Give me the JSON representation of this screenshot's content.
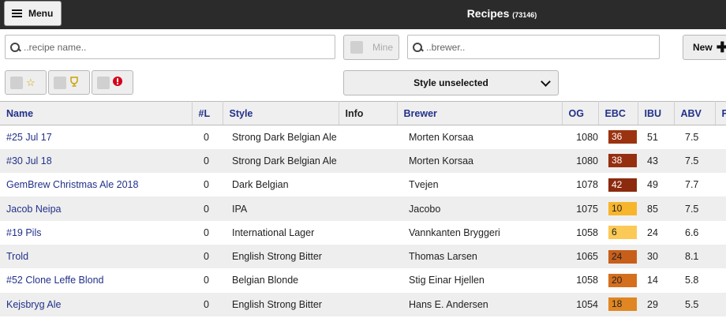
{
  "header": {
    "menu_label": "Menu",
    "title": "Recipes",
    "count": "(73146)"
  },
  "search": {
    "recipe_placeholder": "..recipe name..",
    "brewer_placeholder": "..brewer..",
    "mine_label": "Mine",
    "new_label": "New"
  },
  "filters": {
    "style_label": "Style unselected",
    "favorite_icon": "star-icon",
    "trophy_icon": "trophy-icon",
    "alert_icon": "exclamation-icon"
  },
  "table": {
    "columns": [
      "Name",
      "#L",
      "Style",
      "Info",
      "Brewer",
      "OG",
      "EBC",
      "IBU",
      "ABV",
      "F"
    ],
    "rows": [
      {
        "name": "#25 Jul 17",
        "l": "0",
        "style": "Strong Dark Belgian Ale",
        "info": "",
        "brewer": "Morten Korsaa",
        "og": "1080",
        "ebc": "36",
        "ebc_color": "#9b3311",
        "ebc_text": "#ffffff",
        "ibu": "51",
        "abv": "7.5"
      },
      {
        "name": "#30 Jul 18",
        "l": "0",
        "style": "Strong Dark Belgian Ale",
        "info": "",
        "brewer": "Morten Korsaa",
        "og": "1080",
        "ebc": "38",
        "ebc_color": "#952f10",
        "ebc_text": "#ffffff",
        "ibu": "43",
        "abv": "7.5"
      },
      {
        "name": "GemBrew Christmas Ale 2018",
        "l": "0",
        "style": "Dark Belgian",
        "info": "",
        "brewer": "Tvejen",
        "og": "1078",
        "ebc": "42",
        "ebc_color": "#8c2a0e",
        "ebc_text": "#ffffff",
        "ibu": "49",
        "abv": "7.7"
      },
      {
        "name": "Jacob Neipa",
        "l": "0",
        "style": "IPA",
        "info": "",
        "brewer": "Jacobo",
        "og": "1075",
        "ebc": "10",
        "ebc_color": "#f7b52c",
        "ebc_text": "#222222",
        "ibu": "85",
        "abv": "7.5"
      },
      {
        "name": "#19 Pils",
        "l": "0",
        "style": "International Lager",
        "info": "",
        "brewer": "Vannkanten Bryggeri",
        "og": "1058",
        "ebc": "6",
        "ebc_color": "#fbc955",
        "ebc_text": "#222222",
        "ibu": "24",
        "abv": "6.6"
      },
      {
        "name": "Trold",
        "l": "0",
        "style": "English Strong Bitter",
        "info": "",
        "brewer": "Thomas Larsen",
        "og": "1065",
        "ebc": "24",
        "ebc_color": "#c75f1b",
        "ebc_text": "#222222",
        "ibu": "30",
        "abv": "8.1"
      },
      {
        "name": "#52 Clone Leffe Blond",
        "l": "0",
        "style": "Belgian Blonde",
        "info": "",
        "brewer": "Stig Einar Hjellen",
        "og": "1058",
        "ebc": "20",
        "ebc_color": "#d46f1d",
        "ebc_text": "#222222",
        "ibu": "14",
        "abv": "5.8"
      },
      {
        "name": "Kejsbryg Ale",
        "l": "0",
        "style": "English Strong Bitter",
        "info": "",
        "brewer": "Hans E. Andersen",
        "og": "1054",
        "ebc": "18",
        "ebc_color": "#e08622",
        "ebc_text": "#222222",
        "ibu": "29",
        "abv": "5.5"
      }
    ]
  }
}
